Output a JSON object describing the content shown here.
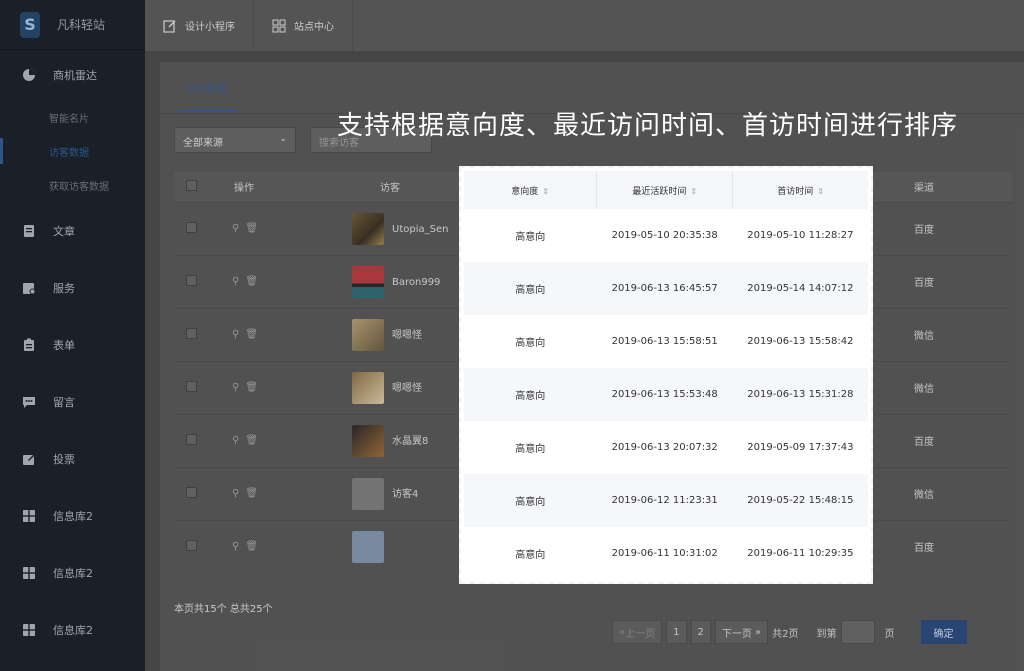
{
  "brand": {
    "name": "凡科轻站",
    "logo_letter": "S"
  },
  "sidebar": {
    "radar": {
      "label": "商机雷达",
      "icon": "pie-chart-icon"
    },
    "sub_items": [
      {
        "label": "智能名片",
        "active": false
      },
      {
        "label": "访客数据",
        "active": true
      },
      {
        "label": "获取访客数据",
        "active": false
      }
    ],
    "items": [
      {
        "label": "文章",
        "icon": "document-icon"
      },
      {
        "label": "服务",
        "icon": "service-icon"
      },
      {
        "label": "表单",
        "icon": "form-icon"
      },
      {
        "label": "留言",
        "icon": "message-icon"
      },
      {
        "label": "投票",
        "icon": "vote-icon"
      },
      {
        "label": "信息库2",
        "icon": "grid-icon"
      },
      {
        "label": "信息库2",
        "icon": "grid-icon"
      },
      {
        "label": "信息库2",
        "icon": "grid-icon"
      }
    ]
  },
  "topbar": {
    "design_label": "设计小程序",
    "site_center_label": "站点中心"
  },
  "main": {
    "tab_label": "访客数据",
    "source_select": "全部来源",
    "search_placeholder": "搜索访客",
    "columns": {
      "op": "操作",
      "visitor": "访客",
      "channel": "渠道"
    },
    "rows": [
      {
        "name": "Utopia_Sen",
        "channel": "百度"
      },
      {
        "name": "Baron999",
        "channel": "百度"
      },
      {
        "name": "嗯嗯怪",
        "channel": "微信"
      },
      {
        "name": "嗯嗯怪",
        "channel": "微信"
      },
      {
        "name": "水晶翼8",
        "channel": "百度"
      },
      {
        "name": "访客4",
        "channel": "微信"
      },
      {
        "name": "",
        "channel": "百度"
      }
    ],
    "footer_count": "本页共15个   总共25个"
  },
  "pager": {
    "prev": "上一页",
    "pages": [
      "1",
      "2"
    ],
    "next": "下一页",
    "total_pages": "共2页",
    "goto_label": "到第",
    "page_unit": "页",
    "confirm": "确定"
  },
  "caption": "支持根据意向度、最近访问时间、首访时间进行排序",
  "popup": {
    "headers": {
      "intent": "意向度",
      "recent": "最近活跃时间",
      "first": "首访时间"
    },
    "rows": [
      {
        "intent": "高意向",
        "recent": "2019-05-10 20:35:38",
        "first": "2019-05-10 11:28:27"
      },
      {
        "intent": "高意向",
        "recent": "2019-06-13 16:45:57",
        "first": "2019-05-14 14:07:12"
      },
      {
        "intent": "高意向",
        "recent": "2019-06-13 15:58:51",
        "first": "2019-06-13 15:58:42"
      },
      {
        "intent": "高意向",
        "recent": "2019-06-13 15:53:48",
        "first": "2019-06-13 15:31:28"
      },
      {
        "intent": "高意向",
        "recent": "2019-06-13 20:07:32",
        "first": "2019-05-09 17:37:43"
      },
      {
        "intent": "高意向",
        "recent": "2019-06-12 11:23:31",
        "first": "2019-05-22 15:48:15"
      },
      {
        "intent": "高意向",
        "recent": "2019-06-11 10:31:02",
        "first": "2019-06-11 10:29:35"
      }
    ]
  }
}
